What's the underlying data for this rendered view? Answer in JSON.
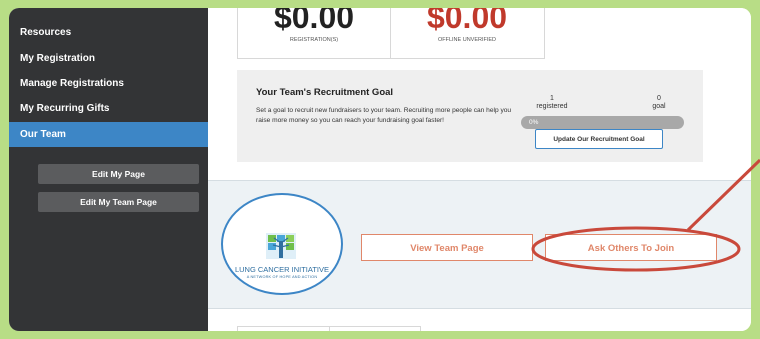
{
  "sidebar": {
    "items": [
      {
        "label": "Resources",
        "active": false
      },
      {
        "label": "My Registration",
        "active": false
      },
      {
        "label": "Manage Registrations",
        "active": false
      },
      {
        "label": "My Recurring Gifts",
        "active": false
      },
      {
        "label": "Our Team",
        "active": true
      }
    ],
    "buttons": {
      "edit_my_page": "Edit My Page",
      "edit_my_team_page": "Edit My Team Page"
    }
  },
  "stats": {
    "registrations": {
      "amount": "$0.00",
      "label": "REGISTRATION(S)",
      "color": "#222222"
    },
    "offline": {
      "amount": "$0.00",
      "label": "OFFLINE UNVERIFIED",
      "color": "#c0392b"
    }
  },
  "goal": {
    "title": "Your Team's Recruitment Goal",
    "description": "Set a goal to recruit new fundraisers to your team. Recruiting more people can help you raise more money so you can reach your fundraising goal faster!",
    "registered_value": "1",
    "registered_label": "registered",
    "goal_value": "0",
    "goal_label": "goal",
    "progress_label": "0%",
    "progress_fraction": 0,
    "update_button": "Update Our Recruitment Goal"
  },
  "team": {
    "logo_name": "LUNG CANCER INITIATIVE",
    "logo_tagline": "A NETWORK OF HOPE AND ACTION",
    "view_button": "View Team Page",
    "ask_button": "Ask Others To Join"
  },
  "colors": {
    "accent_blue": "#3d86c6",
    "orange": "#e0876a",
    "annotation_red": "#c9493b",
    "page_green": "#b8dd86"
  }
}
